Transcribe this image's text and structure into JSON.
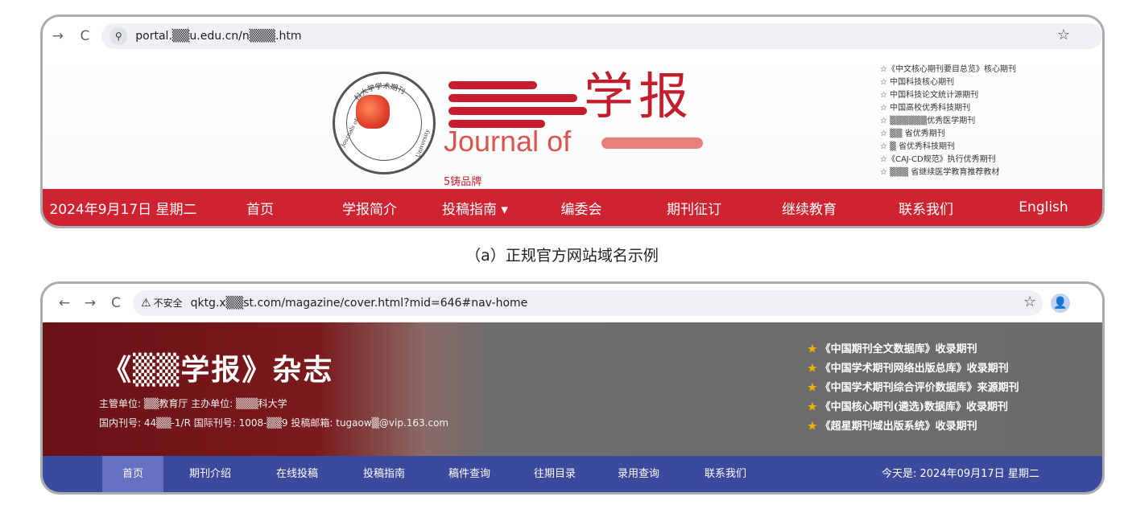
{
  "example_a": {
    "url": "portal.▒▒u.edu.cn/n▒▒▒.htm",
    "logo": {
      "seal_text_top": "科大学学术期刊",
      "seal_text_left": "Journals of",
      "seal_text_right": "University",
      "name_cn": "学报",
      "name_en": "Journal of",
      "tagline": "5铸品牌"
    },
    "honors": [
      "☆《中文核心期刊要目总览》核心期刊",
      "☆ 中国科技核心期刊",
      "☆ 中国科技论文统计源期刊",
      "☆ 中国高校优秀科技期刊",
      "☆ ▒▒▒▒▒▒优秀医学期刊",
      "☆ ▒▒ 省优秀期刊",
      "☆ ▒ 省优秀科技期刊",
      "☆《CAJ-CD规范》执行优秀期刊",
      "☆ ▒▒▒ 省继续医学教育推荐教材"
    ],
    "nav": [
      "2024年9月17日 星期二",
      "首页",
      "学报简介",
      "投稿指南 ▾",
      "编委会",
      "期刊征订",
      "继续教育",
      "联系我们",
      "English"
    ],
    "colors": {
      "nav_bg": "#cf2331",
      "brand": "#c41d2c"
    }
  },
  "caption_a": "（a）正规官方网站域名示例",
  "example_b": {
    "security_label": "不安全",
    "url": "qktg.x▒▒st.com/magazine/cover.html?mid=646#nav-home",
    "title": "《▒▒学报》杂志",
    "info_line1": "主管单位: ▒▒教育厅    主办单位: ▒▒▒科大学",
    "info_line2": "国内刊号: 44▒▒-1/R    国际刊号: 1008-▒▒9    投稿邮箱: tugaow▒@vip.163.com",
    "honors": [
      "《中国期刊全文数据库》收录期刊",
      "《中国学术期刊网络出版总库》收录期刊",
      "《中国学术期刊综合评价数据库》来源期刊",
      "《中国核心期刊(遴选)数据库》收录期刊",
      "《超星期刊域出版系统》收录期刊"
    ],
    "nav": [
      "首页",
      "期刊介绍",
      "在线投稿",
      "投稿指南",
      "稿件查询",
      "往期目录",
      "录用查询",
      "联系我们"
    ],
    "date": "今天是: 2024年09月17日 星期二",
    "colors": {
      "header_left": "#6a1116",
      "header_right": "#6b6b6b",
      "nav_bg": "#3c4a9e",
      "nav_active": "#6470c2",
      "star": "#f0b400"
    }
  },
  "icons": {
    "back": "←",
    "forward": "→",
    "reload": "C",
    "site_settings": "⚲",
    "warning": "⚠",
    "bookmark": "☆",
    "profile": "👤"
  }
}
